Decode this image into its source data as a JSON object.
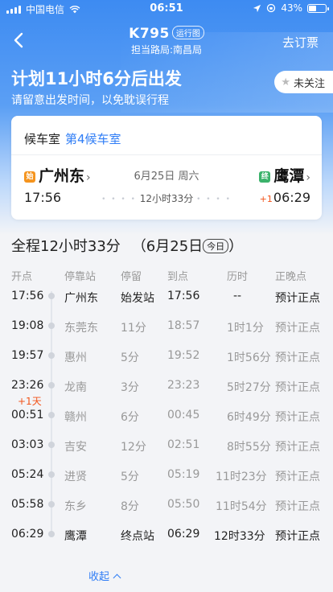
{
  "status_bar": {
    "carrier": "中国电信",
    "time": "06:51",
    "battery": "43%",
    "battery_level": 0.43
  },
  "nav": {
    "train_no": "K795",
    "tag": "运行图",
    "subtitle": "担当路局:南昌局",
    "cancel_label": "去订票"
  },
  "hero": {
    "countdown": "计划11小时6分后出发",
    "hint": "请留意出发时间，以免耽误行程",
    "follow_label": "未关注"
  },
  "card": {
    "waiting_label": "候车室",
    "waiting_value": "第4候车室",
    "from_badge": "始",
    "from_station": "广州东",
    "date": "6月25日 周六",
    "to_badge": "终",
    "to_station": "鹰潭",
    "dep_time": "17:56",
    "duration": "12小时33分",
    "arr_plus": "+1",
    "arr_time": "06:29",
    "chev": "›",
    "dots_left": "• • • •",
    "dots_right": "• • • •"
  },
  "summary": {
    "total": "全程12小时33分",
    "date": "（6月25日",
    "today": "今日",
    "close": "）"
  },
  "table": {
    "headers": [
      "开点",
      "停靠站",
      "停留",
      "到点",
      "历时",
      "正晚点"
    ],
    "plus_day": "+1天",
    "rows": [
      {
        "dep": "17:56",
        "station": "广州东",
        "stop": "始发站",
        "arr": "17:56",
        "elapsed": "--",
        "status": "预计正点"
      },
      {
        "dep": "19:08",
        "station": "东莞东",
        "stop": "11分",
        "arr": "18:57",
        "elapsed": "1时1分",
        "status": "预计正点"
      },
      {
        "dep": "19:57",
        "station": "惠州",
        "stop": "5分",
        "arr": "19:52",
        "elapsed": "1时56分",
        "status": "预计正点"
      },
      {
        "dep": "23:26",
        "station": "龙南",
        "stop": "3分",
        "arr": "23:23",
        "elapsed": "5时27分",
        "status": "预计正点"
      },
      {
        "dep": "00:51",
        "station": "赣州",
        "stop": "6分",
        "arr": "00:45",
        "elapsed": "6时49分",
        "status": "预计正点"
      },
      {
        "dep": "03:03",
        "station": "吉安",
        "stop": "12分",
        "arr": "02:51",
        "elapsed": "8时55分",
        "status": "预计正点"
      },
      {
        "dep": "05:24",
        "station": "进贤",
        "stop": "5分",
        "arr": "05:19",
        "elapsed": "11时23分",
        "status": "预计正点"
      },
      {
        "dep": "05:58",
        "station": "东乡",
        "stop": "8分",
        "arr": "05:50",
        "elapsed": "11时54分",
        "status": "预计正点"
      },
      {
        "dep": "06:29",
        "station": "鹰潭",
        "stop": "终点站",
        "arr": "06:29",
        "elapsed": "12时33分",
        "status": "预计正点"
      }
    ]
  },
  "collapse_label": "收起",
  "colors": {
    "accent": "#2f7df6",
    "hero": "#3d8bf2",
    "warn": "#f2541b",
    "start_badge": "#f5941e",
    "end_badge": "#3bb26b"
  }
}
